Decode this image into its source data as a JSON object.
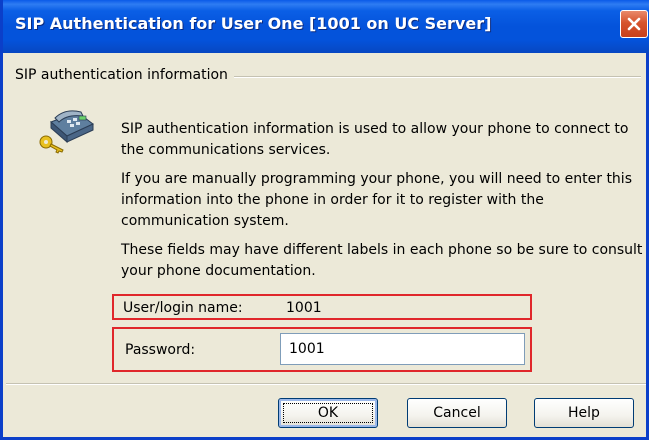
{
  "window": {
    "title": "SIP Authentication for User One [1001 on UC Server]"
  },
  "group": {
    "label": "SIP authentication information"
  },
  "paragraphs": {
    "p1": "SIP authentication information is used to allow your phone to connect to the communications services.",
    "p2": "If you are manually programming your phone, you will need to enter this information into the phone in order for it to register with the communication system.",
    "p3": "These fields may have different labels in each phone so be sure to consult your phone documentation."
  },
  "fields": {
    "user_label": "User/login name:",
    "user_value": "1001",
    "password_label": "Password:",
    "password_value": "1001"
  },
  "buttons": {
    "ok": "OK",
    "cancel": "Cancel",
    "help": "Help"
  },
  "icons": {
    "title_close": "close-icon",
    "dialog_icon": "phone-key-icon"
  },
  "colors": {
    "titlebar": "#0453db",
    "highlight_border": "#e0272b",
    "close_button": "#d6542d",
    "dialog_bg": "#ece9d8"
  }
}
